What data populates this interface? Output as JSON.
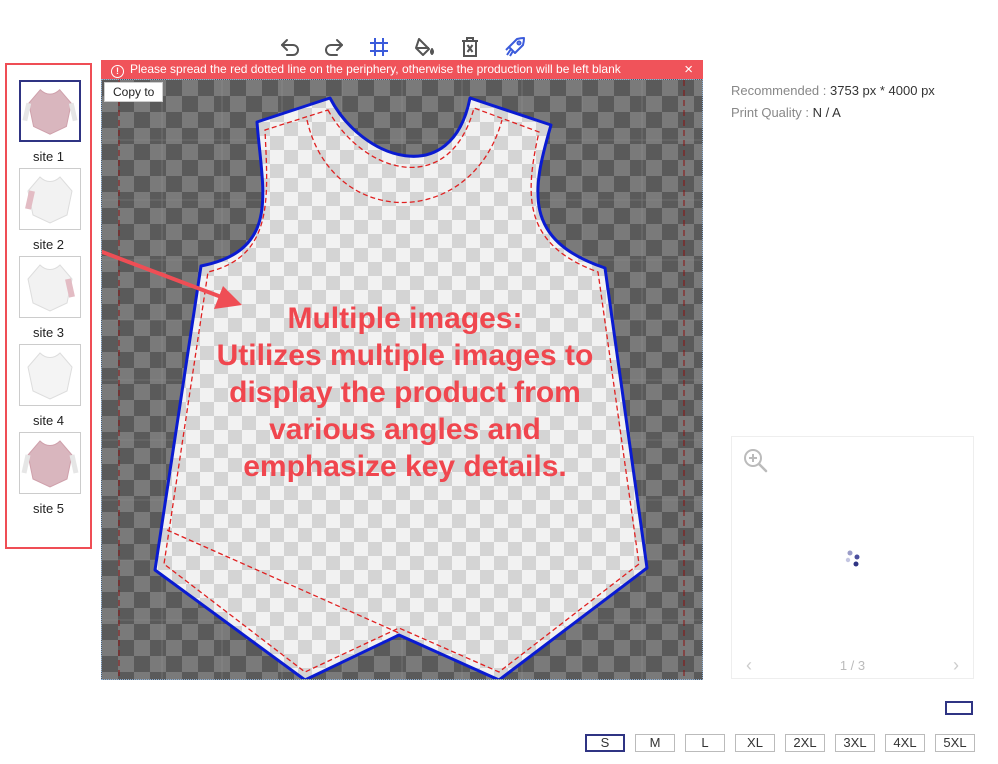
{
  "toolbar": {
    "items": [
      "undo-icon",
      "redo-icon",
      "grid-icon",
      "fill-icon",
      "delete-icon",
      "rocket-icon"
    ],
    "icon_color": "#555555",
    "accent_color": "#3b5bdb"
  },
  "warning": {
    "text": "Please spread the red dotted line on the periphery, otherwise the production will be left blank",
    "close": "×",
    "color": "#f0535a"
  },
  "canvas": {
    "copy_to": "Copy to",
    "callout": [
      "Multiple images:",
      "Utilizes multiple images to",
      "display the product from",
      "various angles and",
      "emphasize key details."
    ],
    "outline_color": "#0a1bd1",
    "dotted_color": "#e02020"
  },
  "thumbnails": [
    {
      "label": "site 1",
      "active": true
    },
    {
      "label": "site 2",
      "active": false
    },
    {
      "label": "site 3",
      "active": false
    },
    {
      "label": "site 4",
      "active": false
    },
    {
      "label": "site 5",
      "active": false
    }
  ],
  "info": {
    "recommended_label": "Recommended : ",
    "recommended_value": "3753 px * 4000 px",
    "quality_label": "Print Quality : ",
    "quality_value": "N / A"
  },
  "preview": {
    "pager": "1 / 3",
    "prev": "‹",
    "next": "›"
  },
  "sizes": {
    "options": [
      "S",
      "M",
      "L",
      "XL",
      "2XL",
      "3XL",
      "4XL",
      "5XL"
    ],
    "selected": "S"
  }
}
